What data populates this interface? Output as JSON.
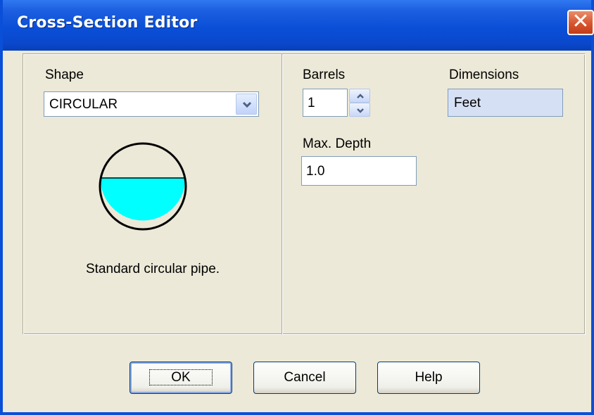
{
  "window": {
    "title": "Cross-Section Editor",
    "close_glyph": "✕"
  },
  "shape": {
    "label": "Shape",
    "selected": "CIRCULAR",
    "description": "Standard circular pipe."
  },
  "barrels": {
    "label": "Barrels",
    "value": "1"
  },
  "dimensions": {
    "label": "Dimensions",
    "value": "Feet"
  },
  "max_depth": {
    "label": "Max. Depth",
    "value": "1.0"
  },
  "buttons": {
    "ok": "OK",
    "cancel": "Cancel",
    "help": "Help"
  },
  "colors": {
    "water": "#00ffff",
    "titlebar": "#0a4fd8",
    "close_button": "#d8542e"
  },
  "icons": [
    "close-icon",
    "chevron-down-icon",
    "spin-up-icon",
    "spin-down-icon"
  ]
}
